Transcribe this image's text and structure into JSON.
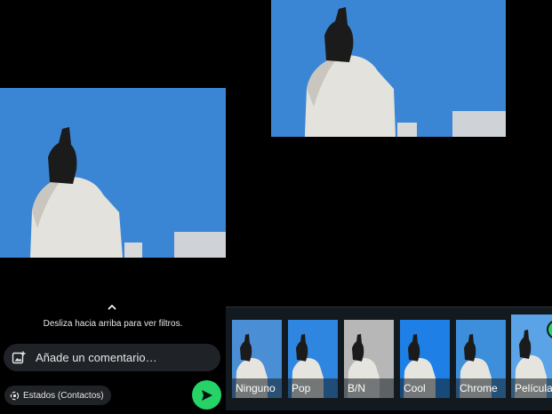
{
  "swipe_hint": "Desliza hacia arriba para ver filtros.",
  "comment": {
    "placeholder": "Añade un comentario…",
    "value": ""
  },
  "status_chip": {
    "label": "Estados (Contactos)"
  },
  "filters": [
    {
      "label": "Ninguno",
      "tint": "#4a8fd6"
    },
    {
      "label": "Pop",
      "tint": "#2f86e0"
    },
    {
      "label": "B/N",
      "tint": "#b7b7b7"
    },
    {
      "label": "Cool",
      "tint": "#1e7fe6"
    },
    {
      "label": "Chrome",
      "tint": "#3d8fdb"
    },
    {
      "label": "Película",
      "tint": "#5aa3e6"
    }
  ],
  "colors": {
    "accent": "#25d366",
    "sky": "#3b86d4",
    "panel": "#1f2226"
  }
}
